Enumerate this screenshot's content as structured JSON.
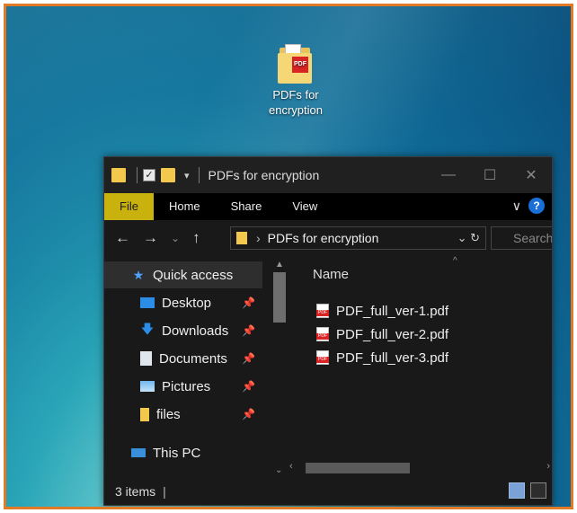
{
  "desktop": {
    "icon": {
      "name": "folder-pdf-icon",
      "label": "PDFs for encryption"
    }
  },
  "window": {
    "title": "PDFs for encryption",
    "controls": {
      "minimize": "—",
      "maximize": "☐",
      "close": "✕"
    },
    "ribbon": {
      "tabs": [
        {
          "label": "File"
        },
        {
          "label": "Home"
        },
        {
          "label": "Share"
        },
        {
          "label": "View"
        }
      ],
      "expand_icon": "chevron-down-icon",
      "help": "?"
    },
    "navbar": {
      "back": "←",
      "forward": "→",
      "recent": "⌄",
      "up": "↑",
      "address": "PDFs for encryption",
      "refresh": "↻",
      "search_placeholder": "Search"
    },
    "nav": {
      "items": [
        {
          "label": "Quick access",
          "icon": "star-icon",
          "pinned": false
        },
        {
          "label": "Desktop",
          "icon": "desktop-icon",
          "pinned": true
        },
        {
          "label": "Downloads",
          "icon": "download-arrow-icon",
          "pinned": true
        },
        {
          "label": "Documents",
          "icon": "document-icon",
          "pinned": true
        },
        {
          "label": "Pictures",
          "icon": "picture-icon",
          "pinned": true
        },
        {
          "label": "files",
          "icon": "folder-icon",
          "pinned": true
        },
        {
          "label": "This PC",
          "icon": "computer-icon",
          "pinned": false
        }
      ]
    },
    "files": {
      "column_header": "Name",
      "rows": [
        {
          "name": "PDF_full_ver-1.pdf"
        },
        {
          "name": "PDF_full_ver-2.pdf"
        },
        {
          "name": "PDF_full_ver-3.pdf"
        }
      ]
    },
    "status": {
      "item_count": "3 items",
      "separator": "|"
    }
  },
  "colors": {
    "accent_border": "#e07a26",
    "file_tab": "#c9b10e",
    "window_bg": "#191919",
    "help_blue": "#1a6fd6",
    "pdf_red": "#d82424"
  }
}
